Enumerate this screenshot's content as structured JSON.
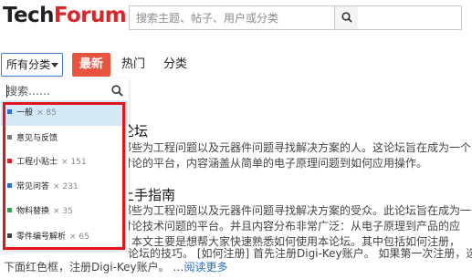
{
  "header": {
    "logo_part1": "Tech",
    "logo_part2": "Forum",
    "search_placeholder": "搜索主题、帖子、用户或分类"
  },
  "nav": {
    "category_select": "所有分类",
    "tabs": [
      {
        "label": "最新",
        "active": true
      },
      {
        "label": "热门",
        "active": false
      },
      {
        "label": "分类",
        "active": false
      }
    ]
  },
  "dropdown": {
    "search_placeholder": "搜索……",
    "items": [
      {
        "label": "一般",
        "count": "× 85",
        "color": "#2a6fca",
        "active": true
      },
      {
        "label": "意见与反馈",
        "count": "",
        "color": "#777777",
        "active": false
      },
      {
        "label": "工程小贴士",
        "count": "× 151",
        "color": "#d8262b",
        "active": false
      },
      {
        "label": "常见问答",
        "count": "× 231",
        "color": "#2a6fca",
        "active": false
      },
      {
        "label": "物料替换",
        "count": "× 35",
        "color": "#34a14a",
        "active": false
      },
      {
        "label": "零件编号解析",
        "count": "× 65",
        "color": "#444444",
        "active": false
      }
    ]
  },
  "posts": {
    "p1_title": "论坛",
    "p1_line1": "那些为工程问题以及元器件问题寻找解决方案的人。这论坛旨在成为一个",
    "p1_line2": "讨论的平台，内容涵盖从简单的电子原理问题到如何应用操作。",
    "p2_title": "上手指南",
    "p2_line1": "那些为工程问题以及元器件问题寻找解决方案的受众。此论坛旨在成为一",
    "p2_line2": "讨论技术问题的平台。并且内容分布非常广泛：从电子原理到产品的应",
    "p2_line3": "。本文主要是想帮大家快速熟悉如何使用本论坛。其中包括如何注册，",
    "p2_line4": "论坛的技巧。 [如何注册] 首先注册Digi-Key账户。 如果第一次注册，选择",
    "p2_line5": "下面红色框，注册Digi-Key账户。 …",
    "read_more": "阅读更多"
  }
}
